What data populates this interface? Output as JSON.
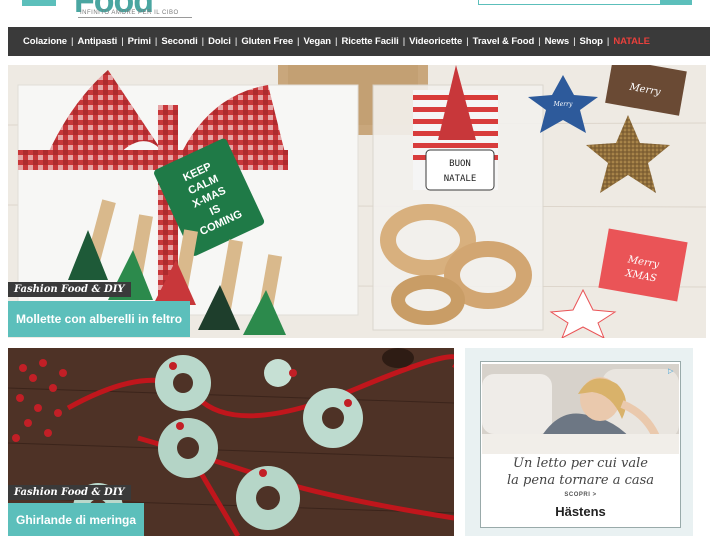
{
  "header": {
    "logo_text": "Food",
    "tagline": "INFINITO AMORE PER IL CIBO"
  },
  "nav": {
    "items": [
      {
        "label": "Colazione"
      },
      {
        "label": "Antipasti"
      },
      {
        "label": "Primi"
      },
      {
        "label": "Secondi"
      },
      {
        "label": "Dolci"
      },
      {
        "label": "Gluten Free"
      },
      {
        "label": "Vegan"
      },
      {
        "label": "Ricette Facili"
      },
      {
        "label": "Videoricette"
      },
      {
        "label": "Travel & Food"
      },
      {
        "label": "News"
      },
      {
        "label": "Shop"
      },
      {
        "label": "NATALE",
        "highlight_color": "#e8403c"
      }
    ]
  },
  "hero": {
    "category": "Fashion Food & DIY",
    "title": "Mollette con alberelli in feltro",
    "tag_text": "KEEP CALM X-MAS IS COMING",
    "bag_label": "BUON NATALE",
    "card_text_1": "Merry XMAS",
    "card_text_2": "Merry XMAS"
  },
  "card2": {
    "category": "Fashion Food & DIY",
    "title": "Ghirlande di meringa"
  },
  "ad": {
    "line1": "Un letto per cui vale",
    "line2": "la pena tornare a casa",
    "cta": "SCOPRI >",
    "brand": "Hästens",
    "adchoices_icon": "adchoices-icon"
  },
  "colors": {
    "accent": "#5cbfbb",
    "nav_bg": "#3a3a3a",
    "highlight": "#e8403c"
  }
}
